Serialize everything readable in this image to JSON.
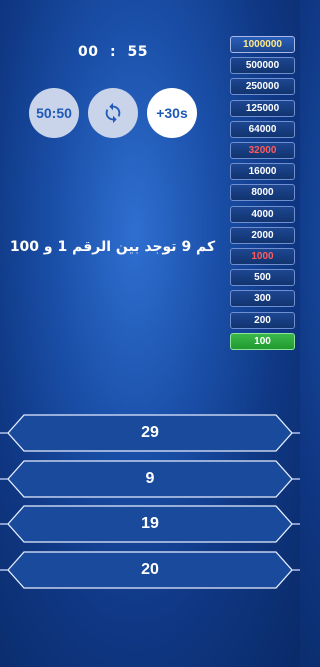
{
  "timer": {
    "minutes": "00",
    "separator": ":",
    "seconds": "55"
  },
  "lifelines": {
    "fifty_fifty": "50:50",
    "swap_icon": "refresh-icon",
    "extra_time": "+30s"
  },
  "prize_ladder": [
    {
      "amount": "1000000",
      "state": "top"
    },
    {
      "amount": "500000",
      "state": "normal"
    },
    {
      "amount": "250000",
      "state": "normal"
    },
    {
      "amount": "125000",
      "state": "normal"
    },
    {
      "amount": "64000",
      "state": "normal"
    },
    {
      "amount": "32000",
      "state": "safe"
    },
    {
      "amount": "16000",
      "state": "normal"
    },
    {
      "amount": "8000",
      "state": "normal"
    },
    {
      "amount": "4000",
      "state": "normal"
    },
    {
      "amount": "2000",
      "state": "normal"
    },
    {
      "amount": "1000",
      "state": "safe"
    },
    {
      "amount": "500",
      "state": "normal"
    },
    {
      "amount": "300",
      "state": "normal"
    },
    {
      "amount": "200",
      "state": "normal"
    },
    {
      "amount": "100",
      "state": "current"
    }
  ],
  "question": "كم 9 توجد بين الرقم 1 و 100",
  "answers": [
    "29",
    "9",
    "19",
    "20"
  ],
  "colors": {
    "ladder_top": "#ffe98a",
    "ladder_safe": "#ff5a5a",
    "ladder_current": "#2eaa3c",
    "lifeline_text": "#1f5ab9"
  }
}
